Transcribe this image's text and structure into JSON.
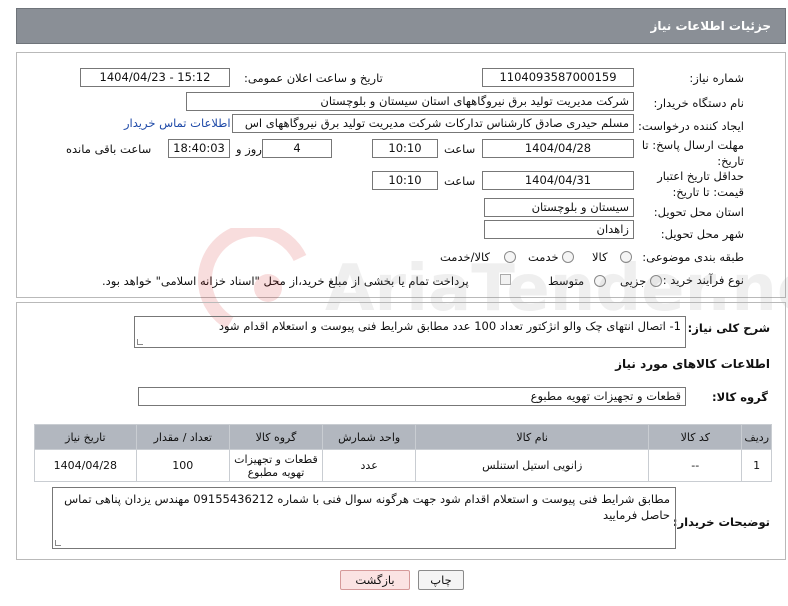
{
  "header": {
    "title": "جزئیات اطلاعات نیاز"
  },
  "form": {
    "need_number_label": "شماره نیاز:",
    "need_number": "1104093587000159",
    "announce_label": "تاریخ و ساعت اعلان عمومی:",
    "announce_value": "1404/04/23 - 15:12",
    "buyer_org_label": "نام دستگاه خریدار:",
    "buyer_org": "شرکت مدیریت تولید برق نیروگاههای استان سیستان و بلوچستان",
    "requester_label": "ایجاد کننده درخواست:",
    "requester": "مسلم حیدری صادق کارشناس تدارکات شرکت مدیریت تولید برق نیروگاههای اس",
    "buyer_contact_link": "اطلاعات تماس خریدار",
    "reply_deadline_label": "مهلت ارسال پاسخ: تا تاریخ:",
    "reply_date": "1404/04/28",
    "time_label": "ساعت",
    "reply_time": "10:10",
    "days_value": "4",
    "days_label": "روز و",
    "remaining_time": "18:40:03",
    "remaining_label": "ساعت باقی مانده",
    "price_validity_label": "حداقل تاریخ اعتبار قیمت: تا تاریخ:",
    "price_date": "1404/04/31",
    "price_time": "10:10",
    "province_label": "استان محل تحویل:",
    "province": "سیستان و بلوچستان",
    "city_label": "شهر محل تحویل:",
    "city": "زاهدان",
    "category_label": "طبقه بندی موضوعی:",
    "category_options": [
      "کالا",
      "خدمت",
      "کالا/خدمت"
    ],
    "process_label": "نوع فرآیند خرید :",
    "process_options": [
      "جزیی",
      "متوسط"
    ],
    "payment_note": "پرداخت تمام یا بخشی از مبلغ خرید،از محل \"اسناد خزانه اسلامی\" خواهد بود."
  },
  "details": {
    "general_desc_label": "شرح کلی نیاز:",
    "general_desc": "1- اتصال انتهای چک والو انژکتور  تعداد  100 عدد  مطابق شرایط فنی پیوست و استعلام اقدام شود",
    "goods_info_title": "اطلاعات کالاهای مورد نیاز",
    "goods_group_label": "گروه کالا:",
    "goods_group": "قطعات و تجهیزات تهویه مطبوع",
    "table": {
      "headers": [
        "ردیف",
        "کد کالا",
        "نام کالا",
        "واحد شمارش",
        "گروه کالا",
        "تعداد / مقدار",
        "تاریخ نیاز"
      ],
      "rows": [
        [
          "1",
          "--",
          "زانویی استیل استنلس",
          "عدد",
          "قطعات و تجهیزات تهویه مطبوع",
          "100",
          "1404/04/28"
        ]
      ]
    },
    "buyer_notes_label": "توضیحات خریدار:",
    "buyer_notes": "مطابق شرایط فنی پیوست و استعلام اقدام شود جهت هرگونه سوال فنی با شماره 09155436212 مهندس یزدان پناهی تماس حاصل فرمایید"
  },
  "buttons": {
    "print": "چاپ",
    "back": "بازگشت"
  },
  "watermark": "AriaTender.neT"
}
